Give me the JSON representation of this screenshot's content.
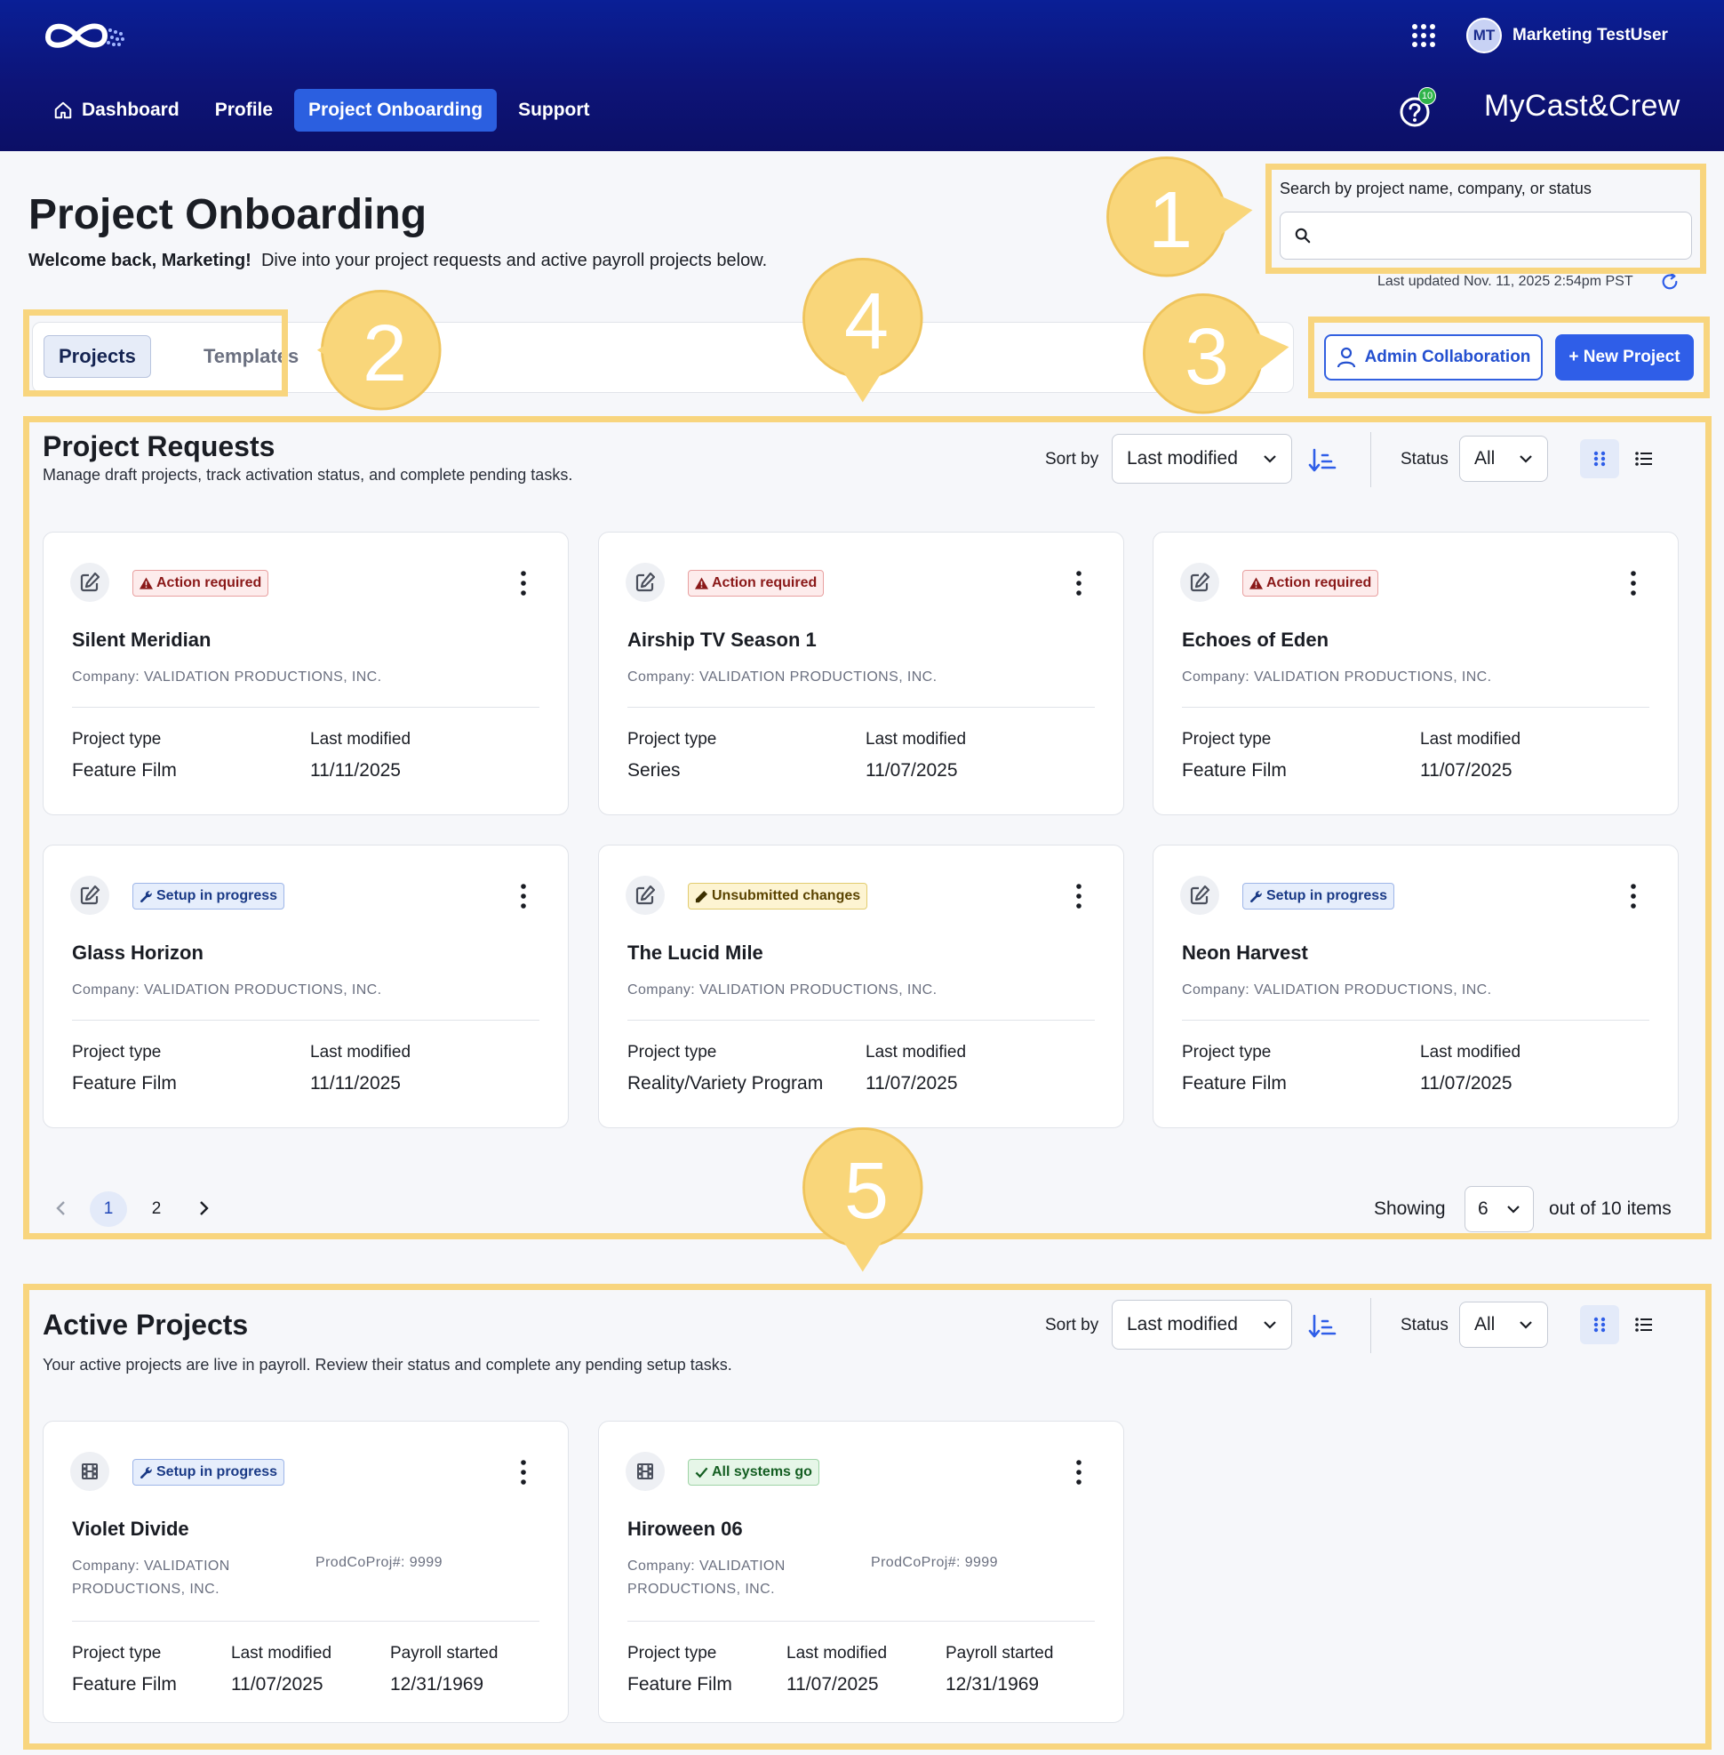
{
  "header": {
    "user_initials": "MT",
    "user_name": "Marketing TestUser",
    "nav": [
      {
        "label": "Dashboard"
      },
      {
        "label": "Profile"
      },
      {
        "label": "Project Onboarding"
      },
      {
        "label": "Support"
      }
    ],
    "help_badge": "10",
    "brand": "MyCast&Crew"
  },
  "page": {
    "title": "Project Onboarding",
    "welcome_bold": "Welcome back, Marketing!",
    "welcome_text": "Dive into your project requests and active payroll projects below.",
    "search_label": "Search by project name, company, or status",
    "search_value": "",
    "last_updated": "Last updated Nov. 11, 2025 2:54pm PST"
  },
  "tabs": [
    {
      "label": "Projects"
    },
    {
      "label": "Templates"
    }
  ],
  "actions": {
    "admin_collab": "Admin Collaboration",
    "new_project": "+ New Project"
  },
  "controls": {
    "sort_by": "Sort by",
    "sort_value": "Last modified",
    "status": "Status",
    "status_value": "All"
  },
  "requests": {
    "title": "Project Requests",
    "subtitle": "Manage draft projects, track activation status, and complete pending tasks.",
    "cards": [
      {
        "badge": "Action required",
        "title": "Silent Meridian",
        "company": "Company: VALIDATION PRODUCTIONS, INC.",
        "type_label": "Project type",
        "type": "Feature Film",
        "mod_label": "Last modified",
        "modified": "11/11/2025"
      },
      {
        "badge": "Action required",
        "title": "Airship TV Season 1",
        "company": "Company: VALIDATION PRODUCTIONS, INC.",
        "type_label": "Project type",
        "type": "Series",
        "mod_label": "Last modified",
        "modified": "11/07/2025"
      },
      {
        "badge": "Action required",
        "title": "Echoes of Eden",
        "company": "Company: VALIDATION PRODUCTIONS, INC.",
        "type_label": "Project type",
        "type": "Feature Film",
        "mod_label": "Last modified",
        "modified": "11/07/2025"
      },
      {
        "badge": "Setup in progress",
        "title": "Glass Horizon",
        "company": "Company: VALIDATION PRODUCTIONS, INC.",
        "type_label": "Project type",
        "type": "Feature Film",
        "mod_label": "Last modified",
        "modified": "11/11/2025"
      },
      {
        "badge": "Unsubmitted changes",
        "title": "The Lucid Mile",
        "company": "Company: VALIDATION PRODUCTIONS, INC.",
        "type_label": "Project type",
        "type": "Reality/Variety Program",
        "mod_label": "Last modified",
        "modified": "11/07/2025"
      },
      {
        "badge": "Setup in progress",
        "title": "Neon Harvest",
        "company": "Company: VALIDATION PRODUCTIONS, INC.",
        "type_label": "Project type",
        "type": "Feature Film",
        "mod_label": "Last modified",
        "modified": "11/07/2025"
      }
    ],
    "pagination": {
      "pages": [
        "1",
        "2"
      ],
      "showing": "Showing",
      "page_size": "6",
      "total": "out of 10 items"
    }
  },
  "active": {
    "title": "Active Projects",
    "subtitle": "Your active projects are live in payroll. Review their status and complete any pending setup tasks.",
    "cards": [
      {
        "badge": "Setup in progress",
        "title": "Violet Divide",
        "company_1": "Company: VALIDATION",
        "company_2": "PRODUCTIONS, INC.",
        "prodco": "ProdCoProj#: 9999",
        "type_label": "Project type",
        "type": "Feature Film",
        "mod_label": "Last modified",
        "modified": "11/07/2025",
        "payroll_label": "Payroll started",
        "payroll": "12/31/1969"
      },
      {
        "badge": "All systems go",
        "title": "Hiroween 06",
        "company_1": "Company: VALIDATION",
        "company_2": "PRODUCTIONS, INC.",
        "prodco": "ProdCoProj#: 9999",
        "type_label": "Project type",
        "type": "Feature Film",
        "mod_label": "Last modified",
        "modified": "11/07/2025",
        "payroll_label": "Payroll started",
        "payroll": "12/31/1969"
      }
    ]
  },
  "annotations": [
    "1",
    "2",
    "3",
    "4",
    "5"
  ],
  "colors": {
    "header": "#0a1f96",
    "accent": "#2f5ee8",
    "highlight": "#f8d57e",
    "bubble": "#f9d67a"
  }
}
